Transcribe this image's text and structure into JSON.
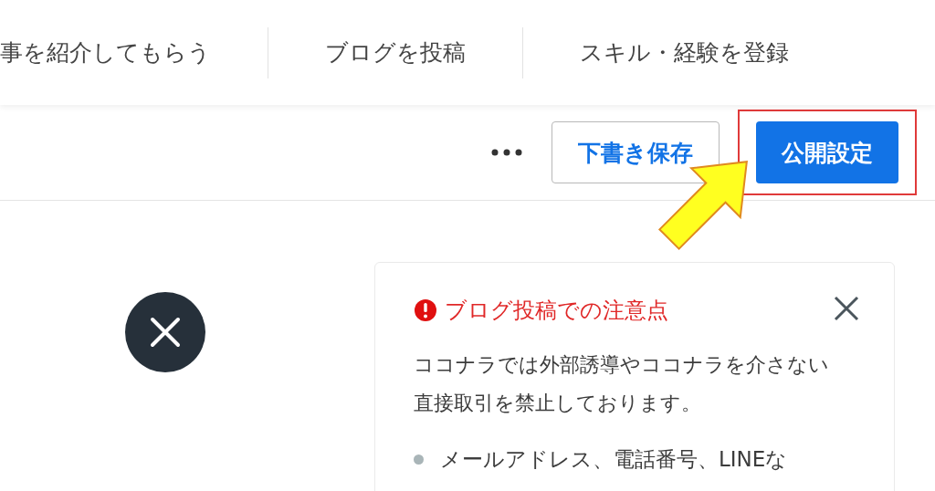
{
  "nav": {
    "tabs": [
      {
        "label": "事を紹介してもらう"
      },
      {
        "label": "ブログを投稿"
      },
      {
        "label": "スキル・経験を登録"
      }
    ]
  },
  "toolbar": {
    "buttons": [
      {
        "kind": "outline",
        "label": "下書き保存",
        "highlighted": false
      },
      {
        "kind": "primary",
        "label": "公開設定",
        "highlighted": true
      }
    ]
  },
  "notice": {
    "title": "ブログ投稿での注意点",
    "body": "ココナラでは外部誘導やココナラを介さない直接取引を禁止しております。",
    "bullets": [
      "メールアドレス、電話番号、LINEな"
    ]
  }
}
